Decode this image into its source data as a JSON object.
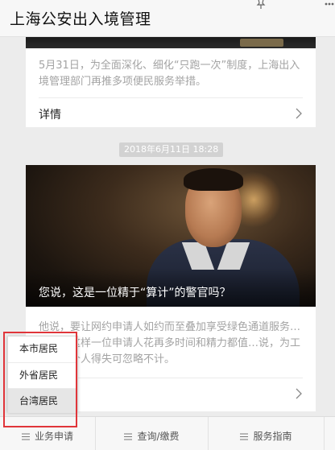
{
  "header": {
    "title": "上海公安出入境管理",
    "icons": [
      "pin-icon",
      "more-icon"
    ]
  },
  "articles": [
    {
      "description": "5月31日，为全面深化、细化“只跑一次”制度，上海出入境管理部门再推多项便民服务举措。",
      "link_label": "详情"
    },
    {
      "timestamp": "2018年6月11日 18:28",
      "image_caption": "您说，这是一位精于“算计”的警官吗？",
      "description": "他说，要让网约申请人如约而至叠加享受绿色通道服务…说，为这样一位申请人花再多时间和精力都值…说，为工作计，个人得失可忽略不计。"
    }
  ],
  "popup_menu": {
    "items": [
      "本市居民",
      "外省居民",
      "台湾居民"
    ],
    "selected": "台湾居民"
  },
  "bottom_nav": {
    "tabs": [
      "业务申请",
      "查询/缴费",
      "服务指南"
    ]
  },
  "colors": {
    "highlight": "#e0353a",
    "background": "#ececec"
  }
}
